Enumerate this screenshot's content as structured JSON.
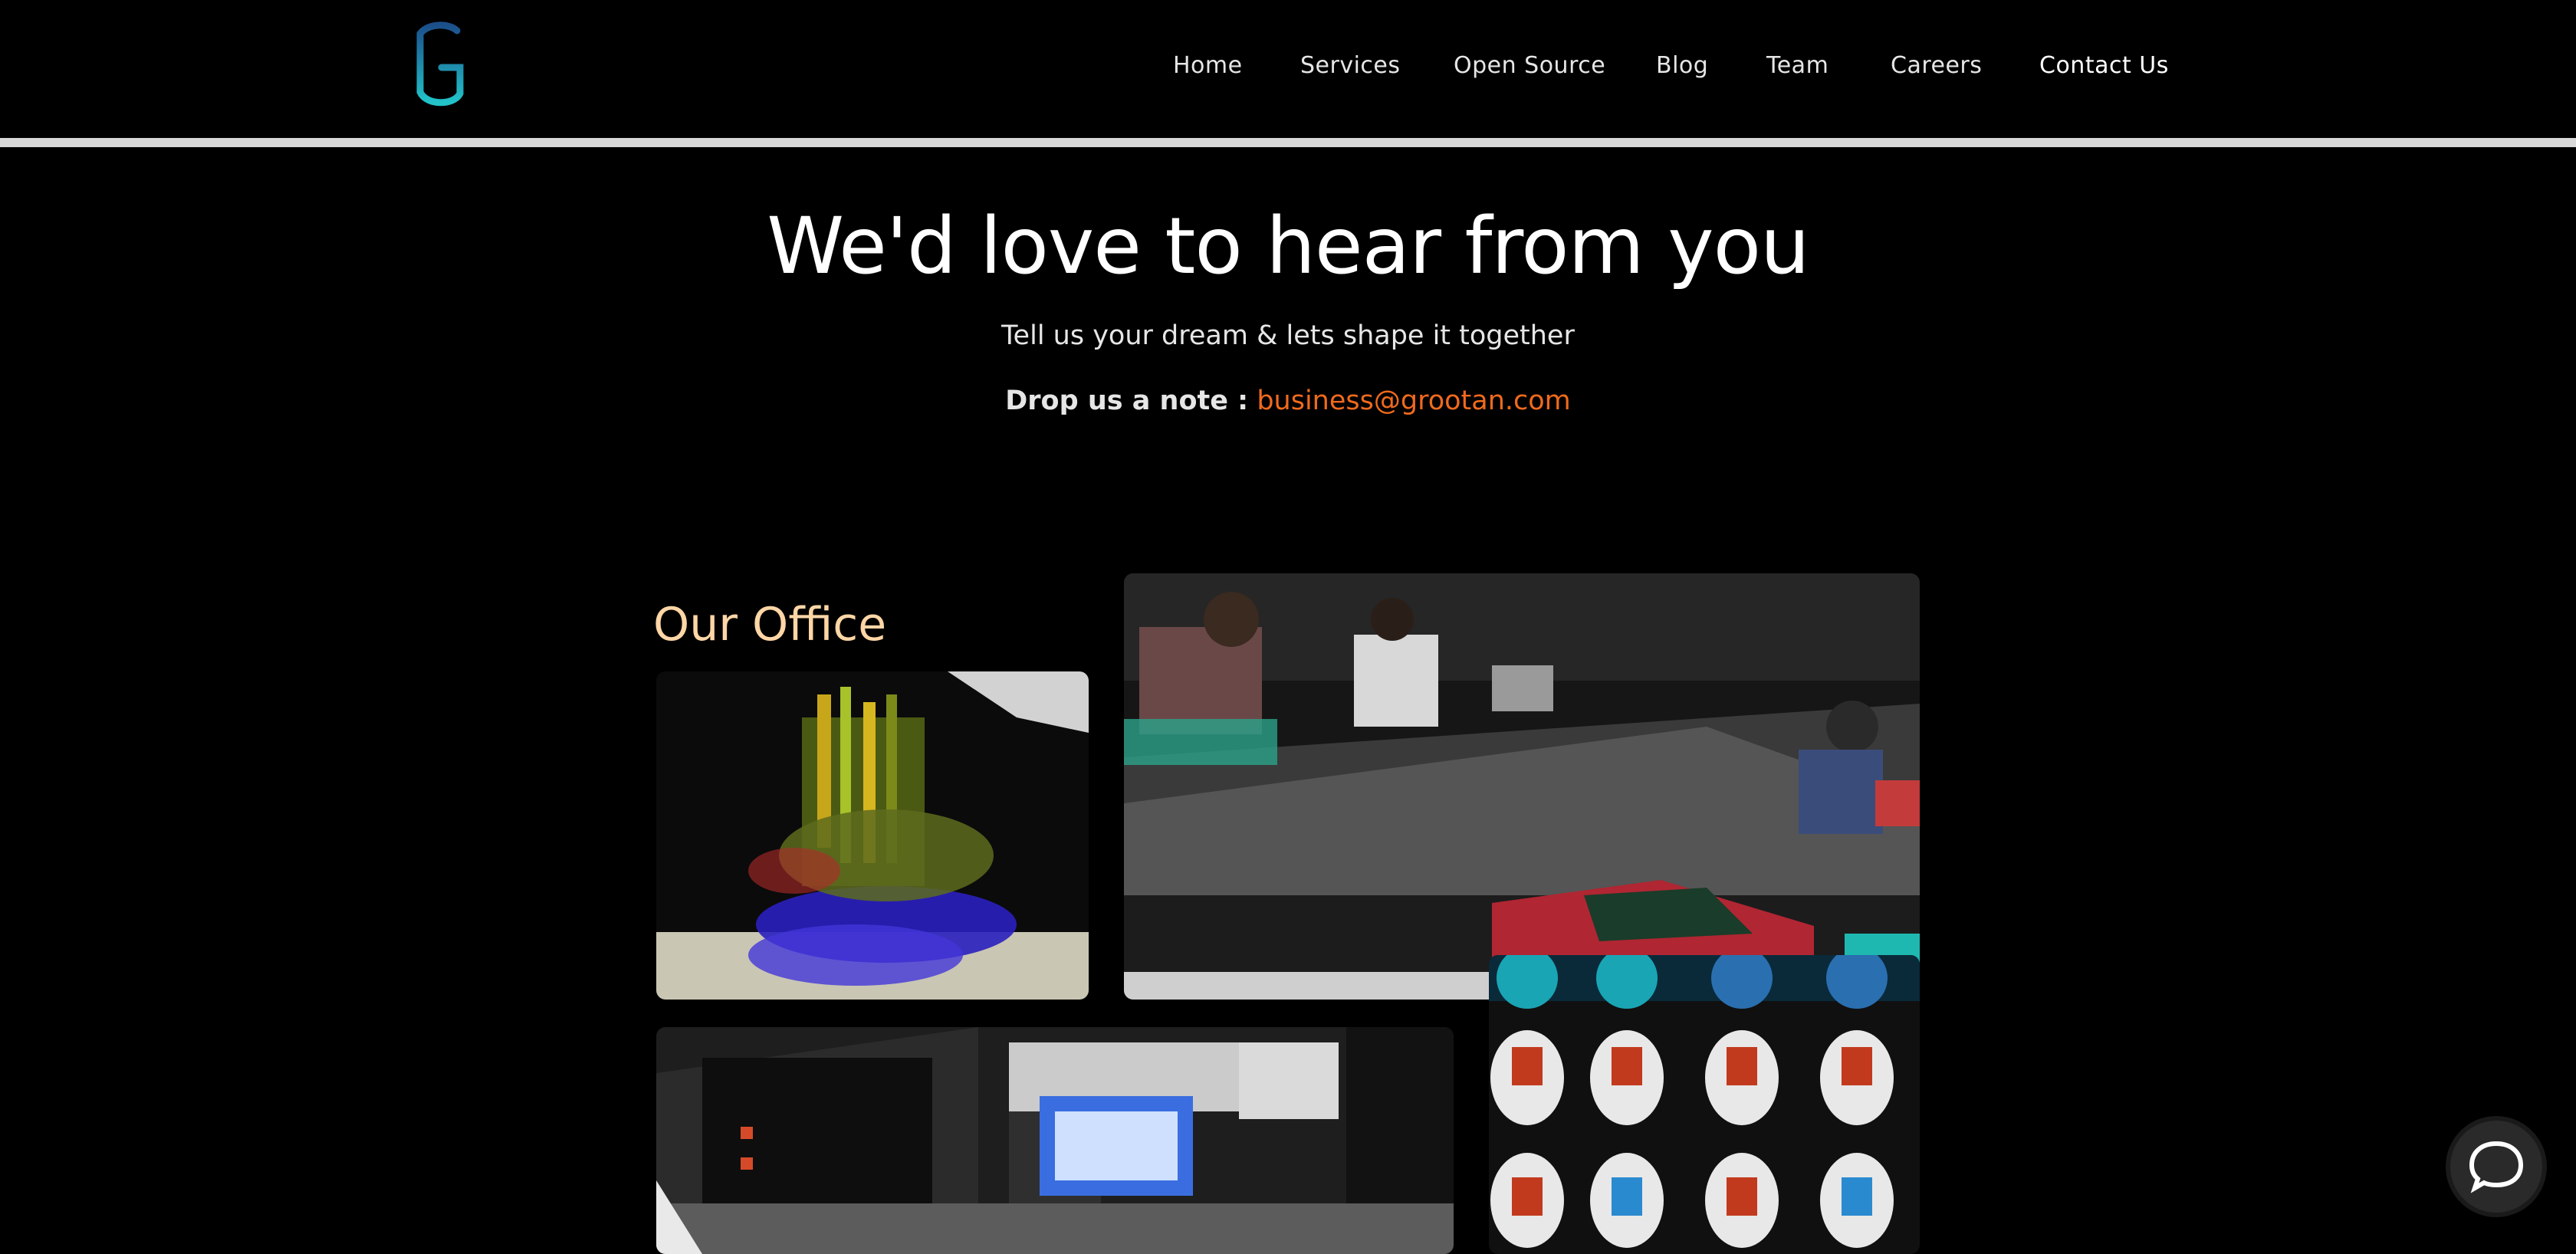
{
  "header": {
    "logo_label": "G",
    "nav": [
      {
        "label": "Home"
      },
      {
        "label": "Services"
      },
      {
        "label": "Open Source"
      },
      {
        "label": "Blog"
      },
      {
        "label": "Team"
      },
      {
        "label": "Careers"
      },
      {
        "label": "Contact Us",
        "active": true
      }
    ]
  },
  "hero": {
    "title": "We'd love to hear from you",
    "subtitle": "Tell us your dream & lets shape it together",
    "note_label": "Drop us a note :",
    "email": "business@grootan.com"
  },
  "office": {
    "title": "Our Office",
    "photos": [
      {
        "name": "office-photo-art"
      },
      {
        "name": "office-photo-team"
      },
      {
        "name": "office-photo-desks"
      },
      {
        "name": "office-photo-badges"
      }
    ]
  },
  "chat": {
    "icon": "chat-icon"
  },
  "colors": {
    "background": "#000000",
    "accent": "#ef6a1d",
    "office_title": "#ffd6a6",
    "logo_teal": "#22b8c5"
  }
}
